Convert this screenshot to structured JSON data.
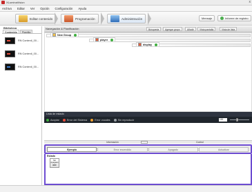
{
  "window": {
    "title": "XLuminaVision",
    "close_glyph": "x"
  },
  "menu": [
    "Archivo",
    "Editar",
    "Ver",
    "Opción",
    "Configuración",
    "Ayuda"
  ],
  "toolbar": {
    "steps": [
      {
        "label": "Editar contenido",
        "icon": "edit-content-icon"
      },
      {
        "label": "Programación",
        "icon": "schedule-icon"
      },
      {
        "label": "Administración",
        "icon": "monitor-icon"
      }
    ],
    "message_label": "Mensaje",
    "report_label": "Informe de registro"
  },
  "left_panel": {
    "title": "Biblioteca",
    "tabs": [
      "Contenido",
      "Plantilla"
    ],
    "items": [
      {
        "label": "RN Contenil_00...",
        "accent": "#e74c3c"
      },
      {
        "label": "RN Contenil_00...",
        "accent": "#e74c3c"
      },
      {
        "label": "RN Contenil_00...",
        "accent": "#3f7fd1"
      }
    ]
  },
  "main_panel": {
    "title": "Navegación  &  Planificación",
    "tools": [
      "Búsqueda",
      "Agregar grupo",
      "Añadir",
      "Vista pantalla",
      "Vista de lista"
    ],
    "nodes": [
      {
        "label": "New Group"
      },
      {
        "label": "player"
      },
      {
        "label": "display"
      }
    ],
    "state_label": "Lista de estado",
    "filters": [
      {
        "label": "Acoplar",
        "color": "#3fae3f"
      },
      {
        "label": "Error del Sistema",
        "color": "#e74c3c"
      },
      {
        "label": "Error vocales",
        "color": "#f0a030"
      },
      {
        "label": "Sin reproducir",
        "color": "#9aa0a6"
      }
    ],
    "zoom": "100"
  },
  "lower": {
    "left_header": "Información",
    "right_header": "Control",
    "tabs": [
      "Ejemplo",
      "Error encendido",
      "Apagado",
      "Actualizar"
    ],
    "active_tab": "Ejemplo",
    "section_title": "Estado",
    "card": {
      "line1": "Sin",
      "line2": "Apagado",
      "line3": "OFF"
    }
  },
  "colors": {
    "accent_purple": "#6c4bd1",
    "ok_green": "#3fae3f",
    "dark_bar": "#1f252c"
  }
}
